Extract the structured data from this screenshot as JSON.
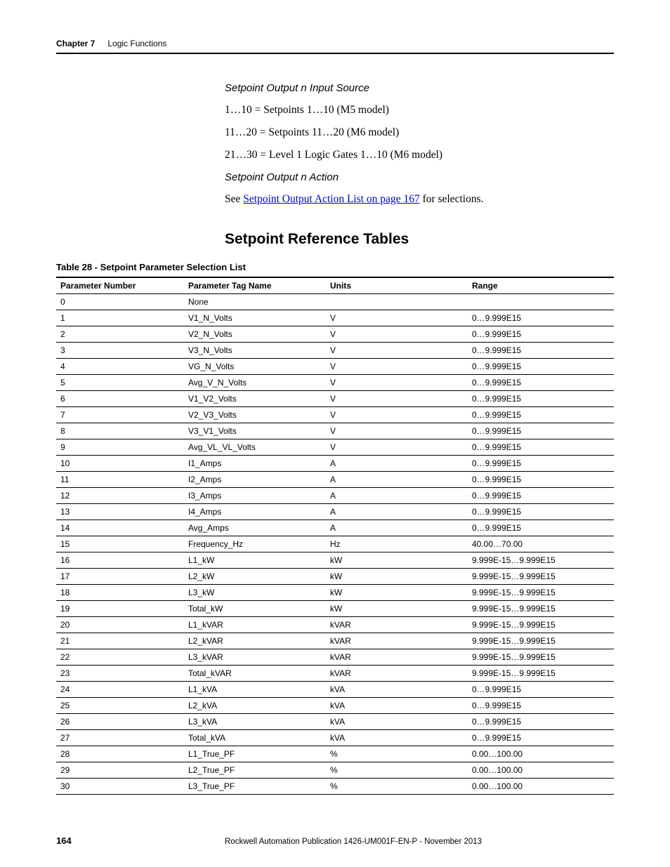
{
  "header": {
    "chapter_label": "Chapter 7",
    "section_label": "Logic Functions"
  },
  "body": {
    "sub1_title": "Setpoint Output n Input Source",
    "line1": "1…10 = Setpoints 1…10 (M5 model)",
    "line2": "11…20 = Setpoints 11…20 (M6 model)",
    "line3": "21…30 = Level 1 Logic Gates 1…10 (M6 model)",
    "sub2_title": "Setpoint Output n Action",
    "see_prefix": "See ",
    "see_link": "Setpoint Output Action List on page 167",
    "see_suffix": " for selections.",
    "section_heading": "Setpoint Reference Tables",
    "table_caption": "Table 28 - Setpoint Parameter Selection List"
  },
  "table": {
    "headers": {
      "c1": "Parameter Number",
      "c2": "Parameter Tag Name",
      "c3": "Units",
      "c4": "Range"
    },
    "rows": [
      {
        "num": "0",
        "tag": "None",
        "units": "",
        "range": ""
      },
      {
        "num": "1",
        "tag": "V1_N_Volts",
        "units": "V",
        "range": "0…9.999E15"
      },
      {
        "num": "2",
        "tag": "V2_N_Volts",
        "units": "V",
        "range": "0…9.999E15"
      },
      {
        "num": "3",
        "tag": "V3_N_Volts",
        "units": "V",
        "range": "0…9.999E15"
      },
      {
        "num": "4",
        "tag": "VG_N_Volts",
        "units": "V",
        "range": "0…9.999E15"
      },
      {
        "num": "5",
        "tag": "Avg_V_N_Volts",
        "units": "V",
        "range": "0…9.999E15"
      },
      {
        "num": "6",
        "tag": "V1_V2_Volts",
        "units": "V",
        "range": "0…9.999E15"
      },
      {
        "num": "7",
        "tag": "V2_V3_Volts",
        "units": "V",
        "range": "0…9.999E15"
      },
      {
        "num": "8",
        "tag": "V3_V1_Volts",
        "units": "V",
        "range": "0…9.999E15"
      },
      {
        "num": "9",
        "tag": "Avg_VL_VL_Volts",
        "units": "V",
        "range": "0…9.999E15"
      },
      {
        "num": "10",
        "tag": "I1_Amps",
        "units": "A",
        "range": "0…9.999E15"
      },
      {
        "num": "11",
        "tag": "I2_Amps",
        "units": "A",
        "range": "0…9.999E15"
      },
      {
        "num": "12",
        "tag": "I3_Amps",
        "units": "A",
        "range": "0…9.999E15"
      },
      {
        "num": "13",
        "tag": "I4_Amps",
        "units": "A",
        "range": "0…9.999E15"
      },
      {
        "num": "14",
        "tag": "Avg_Amps",
        "units": "A",
        "range": "0…9.999E15"
      },
      {
        "num": "15",
        "tag": "Frequency_Hz",
        "units": "Hz",
        "range": "40.00…70.00"
      },
      {
        "num": "16",
        "tag": "L1_kW",
        "units": "kW",
        "range": "9.999E-15…9.999E15"
      },
      {
        "num": "17",
        "tag": "L2_kW",
        "units": "kW",
        "range": "9.999E-15…9.999E15"
      },
      {
        "num": "18",
        "tag": "L3_kW",
        "units": "kW",
        "range": "9.999E-15…9.999E15"
      },
      {
        "num": "19",
        "tag": "Total_kW",
        "units": "kW",
        "range": "9.999E-15…9.999E15"
      },
      {
        "num": "20",
        "tag": "L1_kVAR",
        "units": "kVAR",
        "range": "9.999E-15…9.999E15"
      },
      {
        "num": "21",
        "tag": "L2_kVAR",
        "units": "kVAR",
        "range": "9.999E-15…9.999E15"
      },
      {
        "num": "22",
        "tag": "L3_kVAR",
        "units": "kVAR",
        "range": "9.999E-15…9.999E15"
      },
      {
        "num": "23",
        "tag": "Total_kVAR",
        "units": "kVAR",
        "range": "9.999E-15…9.999E15"
      },
      {
        "num": "24",
        "tag": "L1_kVA",
        "units": "kVA",
        "range": "0…9.999E15"
      },
      {
        "num": "25",
        "tag": "L2_kVA",
        "units": "kVA",
        "range": "0…9.999E15"
      },
      {
        "num": "26",
        "tag": "L3_kVA",
        "units": "kVA",
        "range": "0…9.999E15"
      },
      {
        "num": "27",
        "tag": "Total_kVA",
        "units": "kVA",
        "range": "0…9.999E15"
      },
      {
        "num": "28",
        "tag": "L1_True_PF",
        "units": "%",
        "range": "0.00…100.00"
      },
      {
        "num": "29",
        "tag": "L2_True_PF",
        "units": "%",
        "range": "0.00…100.00"
      },
      {
        "num": "30",
        "tag": "L3_True_PF",
        "units": "%",
        "range": "0.00…100.00"
      }
    ]
  },
  "footer": {
    "page_number": "164",
    "publication": "Rockwell Automation Publication 1426-UM001F-EN-P - November 2013"
  }
}
